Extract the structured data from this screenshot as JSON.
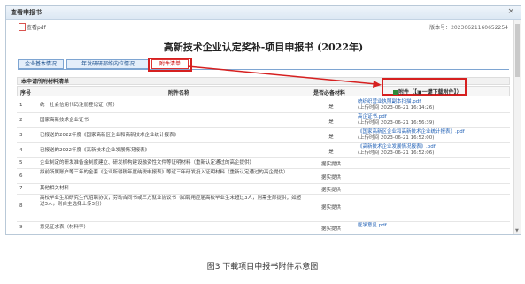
{
  "window": {
    "title": "查看申报书",
    "close": "×"
  },
  "toolbar": {
    "pdf_label": "查看pdf",
    "version": "版本号：20230621160652254"
  },
  "doc_title": "高新技术企业认定奖补-项目申报书 (2022年)",
  "tabs": [
    {
      "label": "企业基本情况"
    },
    {
      "label": "年发研研部维内位情况"
    },
    {
      "label": "附件清单"
    }
  ],
  "section_title": "本申请所附材料清单",
  "download_btn": "附件（【▣一键下载附件】）",
  "table": {
    "headers": {
      "no": "序号",
      "name": "附件名称",
      "required": "是否必备材料",
      "attachment": "附件"
    },
    "rows": [
      {
        "no": "1",
        "name": "统一社会信用代码注册登记证（照）",
        "required": "是",
        "file": "统织织营业执照副本扫描.pdf",
        "time": "(上传时间 2023-06-21 16:14:26)"
      },
      {
        "no": "2",
        "name": "国家高新技术企业证书",
        "required": "是",
        "file": "高企证书.pdf",
        "time": "(上传时间 2023-06-21 16:56:39)"
      },
      {
        "no": "3",
        "name": "已报送的2022年度《国家高新区企业和高新技术企业统计报表》",
        "required": "是",
        "file": "《国家高新区企业和高新技术企业统计报表》.pdf",
        "time": "(上传时间 2023-06-21 16:52:00)"
      },
      {
        "no": "4",
        "name": "已报送的2022年度《高新技术企业发展情况报表》",
        "required": "是",
        "file": "《高新技术企业发展情况报表》.pdf",
        "time": "(上传时间 2023-06-21 16:52:06)"
      },
      {
        "no": "5",
        "name": "企业制定的研发准备金制度建立、研发机构建设融资性文件等证明材料（重新认定通过的高企提供）",
        "required": "据实提供",
        "file": "",
        "time": ""
      },
      {
        "no": "6",
        "name": "拟前所属账户等三年的全套《企业所得税年度纳税申报表》等近三年研发投入证明材料（重新认定通过的高企提供）",
        "required": "据实提供",
        "file": "",
        "time": ""
      },
      {
        "no": "7",
        "name": "其他相关材料",
        "required": "据实提供",
        "file": "",
        "time": ""
      },
      {
        "no": "8",
        "name": "高校毕业生和研究生代招聘协议，劳动合同书或三方就业协议书（如聘用应届高校毕业生未超过3人，则需全部提供；如超过3人，则自主选择上传3份）",
        "required": "据实提供",
        "file": "",
        "time": ""
      },
      {
        "no": "9",
        "name": "意见征求表（材料字）",
        "required": "据实提供",
        "file": "医学意见.pdf",
        "time": ""
      }
    ]
  },
  "caption": "图3 下载项目申报书附件示意图",
  "colors": {
    "accent": "#1f5fb5",
    "highlight": "#d62020"
  }
}
